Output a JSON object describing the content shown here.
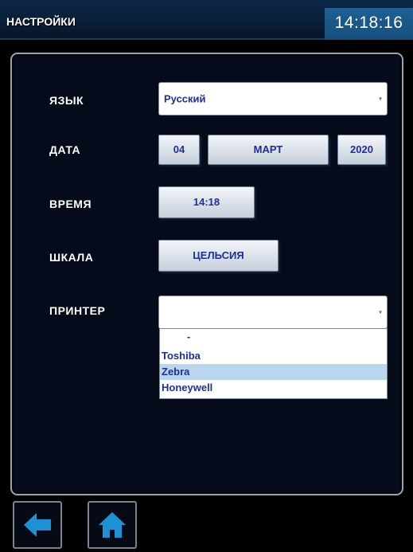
{
  "header": {
    "title": "НАСТРОЙКИ",
    "clock": "14:18:16"
  },
  "settings": {
    "language": {
      "label": "ЯЗЫК",
      "value": "Русский"
    },
    "date": {
      "label": "ДАТА",
      "day": "04",
      "month": "МАРТ",
      "year": "2020"
    },
    "time": {
      "label": "ВРЕМЯ",
      "value": "14:18"
    },
    "scale": {
      "label": "ШКАЛА",
      "value": "ЦЕЛЬСИЯ"
    },
    "printer": {
      "label": "ПРИНТЕР",
      "value": "",
      "options": [
        "-",
        "Toshiba",
        "Zebra",
        "Honeywell"
      ],
      "highlighted_option": "Zebra"
    }
  },
  "footer": {
    "back_icon": "arrow-left-icon",
    "home_icon": "home-icon"
  },
  "colors": {
    "background": "#000000",
    "header_bg": "#0d2847",
    "clock_bg": "#1e5f92",
    "text_accent": "#1d2f9a",
    "icon_blue": "#1e90d6",
    "highlight": "#b9d6ec"
  }
}
